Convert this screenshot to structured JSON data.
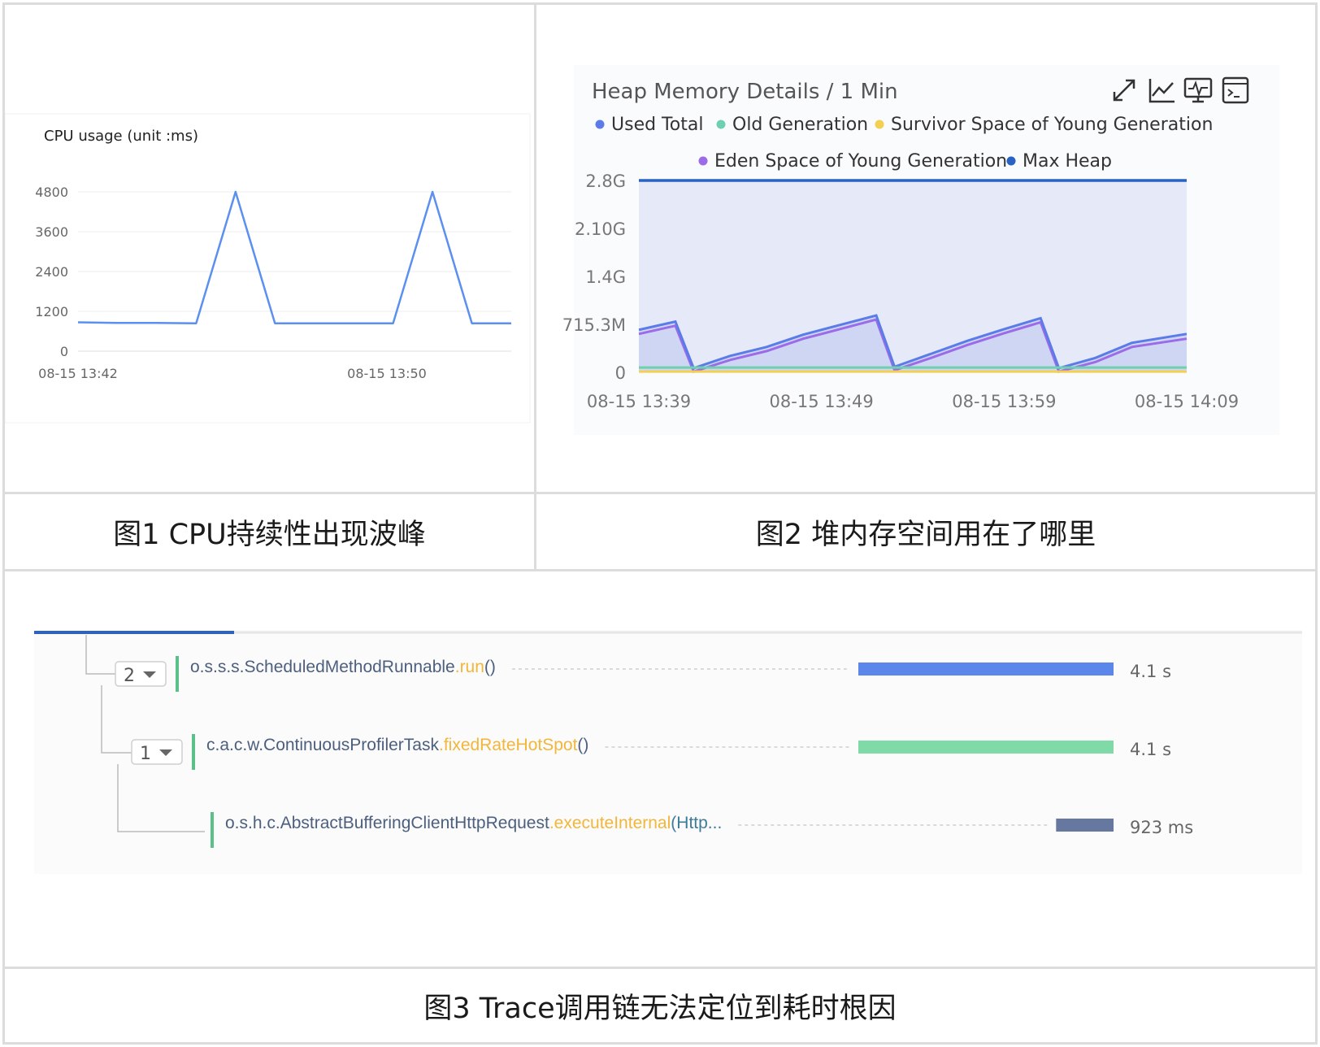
{
  "captions": {
    "fig1": "图1 CPU持续性出现波峰",
    "fig2": "图2 堆内存空间用在了哪里",
    "fig3": "图3 Trace调用链无法定位到耗时根因"
  },
  "icons": [
    "expand-icon",
    "line-chart-icon",
    "monitor-icon",
    "terminal-icon"
  ],
  "colors": {
    "cpu_line": "#5b8ff0",
    "used_total": "#5b7ce8",
    "old_generation": "#6fd0b0",
    "survivor": "#f3cf52",
    "eden": "#9b6be8",
    "max_heap": "#2762c4",
    "trace_bar_1": "#5b87ea",
    "trace_bar_2": "#7fdaa8",
    "trace_bar_3": "#6677a0",
    "trace_method": "#f2b63a"
  },
  "chart_data": [
    {
      "type": "line",
      "title": "CPU usage (unit :ms)",
      "x_tick_labels": [
        "08-15 13:42",
        "08-15 13:50"
      ],
      "y_tick_labels": [
        "0",
        "1200",
        "2400",
        "3600",
        "4800"
      ],
      "ylim": [
        0,
        4800
      ],
      "grid": true,
      "series": [
        {
          "x": [
            0,
            1,
            2,
            3,
            4,
            5,
            6,
            7,
            8,
            9,
            10,
            11
          ],
          "values": [
            870,
            850,
            850,
            840,
            4800,
            840,
            840,
            840,
            840,
            4800,
            840,
            840
          ]
        }
      ]
    },
    {
      "type": "area",
      "title": "Heap Memory Details / 1 Min",
      "legend": [
        "Used Total",
        "Old Generation",
        "Survivor Space of Young Generation",
        "Eden Space of Young Generation",
        "Max Heap"
      ],
      "legend_placement": "top",
      "x_tick_labels": [
        "08-15 13:39",
        "08-15 13:49",
        "08-15 13:59",
        "08-15 14:09"
      ],
      "y_tick_labels": [
        "0",
        "715.3M",
        "1.4G",
        "2.10G",
        "2.8G"
      ],
      "ylim_gb": [
        0,
        2.8
      ],
      "x_minutes": [
        0,
        2,
        3,
        5,
        7,
        9,
        11,
        13,
        14,
        16,
        18,
        20,
        22,
        23,
        25,
        27,
        30
      ],
      "series": [
        {
          "name": "Used Total",
          "values": [
            0.62,
            0.74,
            0.06,
            0.24,
            0.37,
            0.55,
            0.69,
            0.83,
            0.08,
            0.27,
            0.46,
            0.63,
            0.79,
            0.06,
            0.21,
            0.43,
            0.56
          ]
        },
        {
          "name": "Eden Space of Young Generation",
          "values": [
            0.56,
            0.68,
            0.01,
            0.18,
            0.31,
            0.49,
            0.63,
            0.77,
            0.03,
            0.21,
            0.4,
            0.57,
            0.73,
            0.01,
            0.15,
            0.37,
            0.49
          ]
        },
        {
          "name": "Old Generation",
          "values": [
            0.07,
            0.07,
            0.07,
            0.07,
            0.07,
            0.07,
            0.07,
            0.07,
            0.07,
            0.07,
            0.07,
            0.07,
            0.07,
            0.07,
            0.07,
            0.07,
            0.07
          ]
        },
        {
          "name": "Survivor Space of Young Generation",
          "values": [
            0.01,
            0.01,
            0.01,
            0.01,
            0.01,
            0.01,
            0.01,
            0.01,
            0.01,
            0.01,
            0.01,
            0.01,
            0.01,
            0.01,
            0.01,
            0.01,
            0.01
          ]
        },
        {
          "name": "Max Heap",
          "values": [
            2.8,
            2.8,
            2.8,
            2.8,
            2.8,
            2.8,
            2.8,
            2.8,
            2.8,
            2.8,
            2.8,
            2.8,
            2.8,
            2.8,
            2.8,
            2.8,
            2.8
          ]
        }
      ]
    },
    {
      "type": "bar",
      "title": "",
      "orientation": "horizontal",
      "rows": [
        {
          "depth_label": "2",
          "class": "o.s.s.s.ScheduledMethodRunnable",
          "dot": ".",
          "method": "run",
          "suffix": "()",
          "duration_label": "4.1 s",
          "duration_ms": 4100
        },
        {
          "depth_label": "1",
          "class": "c.a.c.w.ContinuousProfilerTask",
          "dot": ".",
          "method": "fixedRateHotSpot",
          "suffix": "()",
          "duration_label": "4.1 s",
          "duration_ms": 4100
        },
        {
          "depth_label": "",
          "class": "o.s.h.c.AbstractBufferingClientHttpRequest",
          "dot": ".",
          "method": "executeInternal",
          "suffix": "(Http...",
          "duration_label": "923 ms",
          "duration_ms": 923
        }
      ],
      "max_duration_ms": 4100
    }
  ]
}
